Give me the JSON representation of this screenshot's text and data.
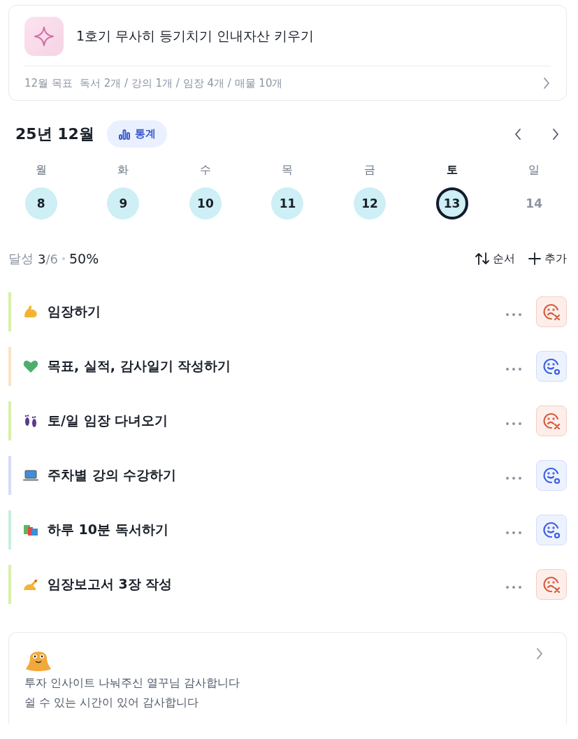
{
  "goal_card": {
    "title": "1호기 무사히 등기치기 인내자산 키우기",
    "label": "12월 목표",
    "summary": "독서 2개 / 강의 1개 / 임장 4개 / 매물 10개"
  },
  "calendar": {
    "month": "25년 12월",
    "stats_button": "통계",
    "days": [
      {
        "weekday": "월",
        "date": "8",
        "recorded": true,
        "selected": false
      },
      {
        "weekday": "화",
        "date": "9",
        "recorded": true,
        "selected": false
      },
      {
        "weekday": "수",
        "date": "10",
        "recorded": true,
        "selected": false
      },
      {
        "weekday": "목",
        "date": "11",
        "recorded": true,
        "selected": false
      },
      {
        "weekday": "금",
        "date": "12",
        "recorded": true,
        "selected": false
      },
      {
        "weekday": "토",
        "date": "13",
        "recorded": true,
        "selected": true
      },
      {
        "weekday": "일",
        "date": "14",
        "recorded": false,
        "selected": false
      }
    ]
  },
  "progress": {
    "label": "달성",
    "done": "3",
    "total": "/6",
    "percent": "50%",
    "sort_button": "순서",
    "add_button": "추가"
  },
  "tasks": [
    {
      "title": "임장하기",
      "color": "#d8efa9",
      "done": false
    },
    {
      "title": "목표, 실적, 감사일기 작성하기",
      "color": "#fce3c6",
      "done": true
    },
    {
      "title": "토/일 임장 다녀오기",
      "color": "#d8efa9",
      "done": false
    },
    {
      "title": "주차별 강의 수강하기",
      "color": "#d6dcf7",
      "done": true
    },
    {
      "title": "하루 10분 독서하기",
      "color": "#c9eedd",
      "done": true
    },
    {
      "title": "임장보고서 3장 작성",
      "color": "#d8efa9",
      "done": false
    }
  ],
  "gratitude": {
    "lines": [
      "투자 인사이트 나눠주신 열꾸님 감사합니다",
      "쉴 수 있는 시간이 있어 감사합니다"
    ]
  }
}
